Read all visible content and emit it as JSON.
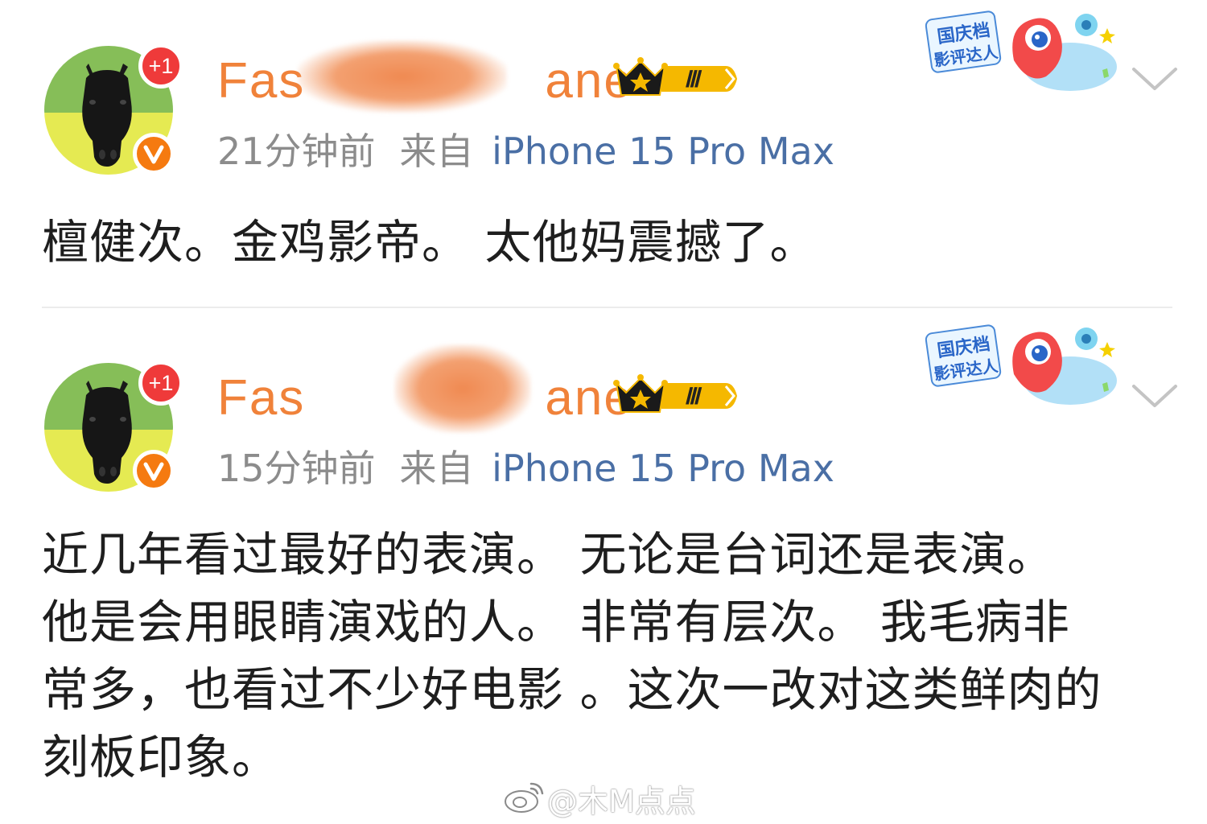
{
  "posts": [
    {
      "username": "Fashio… …hane",
      "username_visible_start": "Fas",
      "username_visible_end": "ane",
      "plus_badge": "+1",
      "verified_badge": "V",
      "member_level": "Ⅲ",
      "time": "21分钟前",
      "from_label": "来自",
      "device": "iPhone 15 Pro Max",
      "sticker_text": [
        "国庆档",
        "影评达人"
      ],
      "text": "檀健次。金鸡影帝。 太他妈震撼了。"
    },
    {
      "username": "Fash… …ane",
      "username_visible_start": "Fas",
      "username_visible_end": "ane",
      "plus_badge": "+1",
      "verified_badge": "V",
      "member_level": "Ⅲ",
      "time": "15分钟前",
      "from_label": "来自",
      "device": "iPhone 15 Pro Max",
      "sticker_text": [
        "国庆档",
        "影评达人"
      ],
      "text_lines": [
        "近几年看过最好的表演。 无论是台词还是表演。",
        "他是会用眼睛演戏的人。 非常有层次。 我毛病非",
        "常多，也看过不少好电影 。这次一改对这类鲜肉的",
        "刻板印象。"
      ]
    }
  ],
  "watermark": "@木M点点",
  "colors": {
    "username": "#f0823a",
    "device_link": "#4a6fa5",
    "meta_gray": "#8c8c8c",
    "plus_badge": "#ef3a3a",
    "verified": "#f57a10",
    "crown_gold": "#f5b800"
  },
  "icons": {
    "avatar": "horse-avatar-icon",
    "verified": "verified-v-icon",
    "member": "crown-member-badge-icon",
    "expand": "chevron-down-icon",
    "watermark": "weibo-logo-icon"
  }
}
